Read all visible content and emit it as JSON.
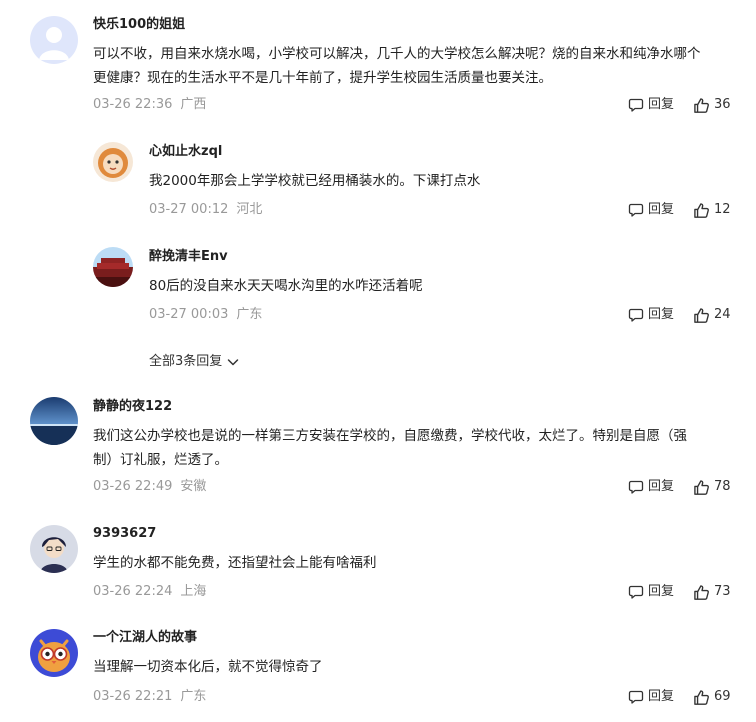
{
  "comments": [
    {
      "username": "快乐100的姐姐",
      "lines": [
        "可以不收，用自来水烧水喝，小学校可以解决，几千人的大学校怎么解决呢？烧的自来水和纯净水哪个",
        "更健康？现在的生活水平不是几十年前了，提升学生校园生活质量也要关注。"
      ],
      "time": "03-26 22:36",
      "location": "广西",
      "reply_label": "回复",
      "likes": "36",
      "replies": [
        {
          "username": "心如止水zql",
          "content": "我2000年那会上学学校就已经用桶装水的。下课打点水",
          "time": "03-27 00:12",
          "location": "河北",
          "reply_label": "回复",
          "likes": "12"
        },
        {
          "username": "醉挽清丰Env",
          "content": "80后的没自来水天天喝水沟里的水咋还活着呢",
          "time": "03-27 00:03",
          "location": "广东",
          "reply_label": "回复",
          "likes": "24"
        }
      ],
      "expand_label": "全部3条回复"
    },
    {
      "username": "静静的夜122",
      "lines": [
        "我们这公办学校也是说的一样第三方安装在学校的，自愿缴费，学校代收，太烂了。特别是自愿（强",
        "制）订礼服，烂透了。"
      ],
      "time": "03-26 22:49",
      "location": "安徽",
      "reply_label": "回复",
      "likes": "78"
    },
    {
      "username": "9393627",
      "lines": [
        "学生的水都不能免费，还指望社会上能有啥福利"
      ],
      "time": "03-26 22:24",
      "location": "上海",
      "reply_label": "回复",
      "likes": "73"
    },
    {
      "username": "一个江湖人的故事",
      "lines": [
        "当理解一切资本化后，就不觉得惊奇了"
      ],
      "time": "03-26 22:21",
      "location": "广东",
      "reply_label": "回复",
      "likes": "69"
    }
  ],
  "icons": {
    "reply": "comment-bubble-icon",
    "like": "thumbs-up-icon",
    "expand": "chevron-down-icon"
  }
}
